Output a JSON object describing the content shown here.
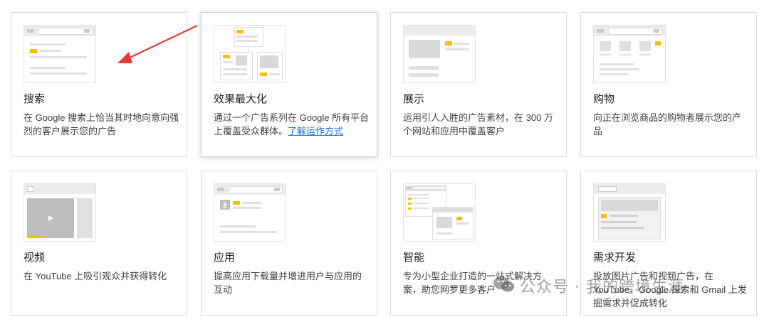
{
  "cards": [
    {
      "title": "搜索",
      "desc": "在 Google 搜索上恰当其时地向意向强烈的客户展示您的广告"
    },
    {
      "title": "效果最大化",
      "desc": "通过一个广告系列在 Google 所有平台上覆盖受众群体。",
      "link": "了解运作方式"
    },
    {
      "title": "展示",
      "desc": "运用引人入胜的广告素材，在 300 万个网站和应用中覆盖客户"
    },
    {
      "title": "购物",
      "desc": "向正在浏览商品的购物者展示您的产品"
    },
    {
      "title": "视频",
      "desc": "在 YouTube 上吸引观众并获得转化"
    },
    {
      "title": "应用",
      "desc": "提高应用下载量并增进用户与应用的互动"
    },
    {
      "title": "智能",
      "desc": "专为小型企业打造的一站式解决方案，助您网罗更多客户"
    },
    {
      "title": "需求开发",
      "desc": "投放图片广告和视频广告，在 YouTube、Google 探索和 Gmail 上发掘需求并促成转化"
    }
  ],
  "watermark": {
    "text": "公众号 · 我的跨境生涯"
  },
  "colors": {
    "accent": "#fbbc04",
    "arrow": "#e53935",
    "link": "#1a73e8"
  }
}
